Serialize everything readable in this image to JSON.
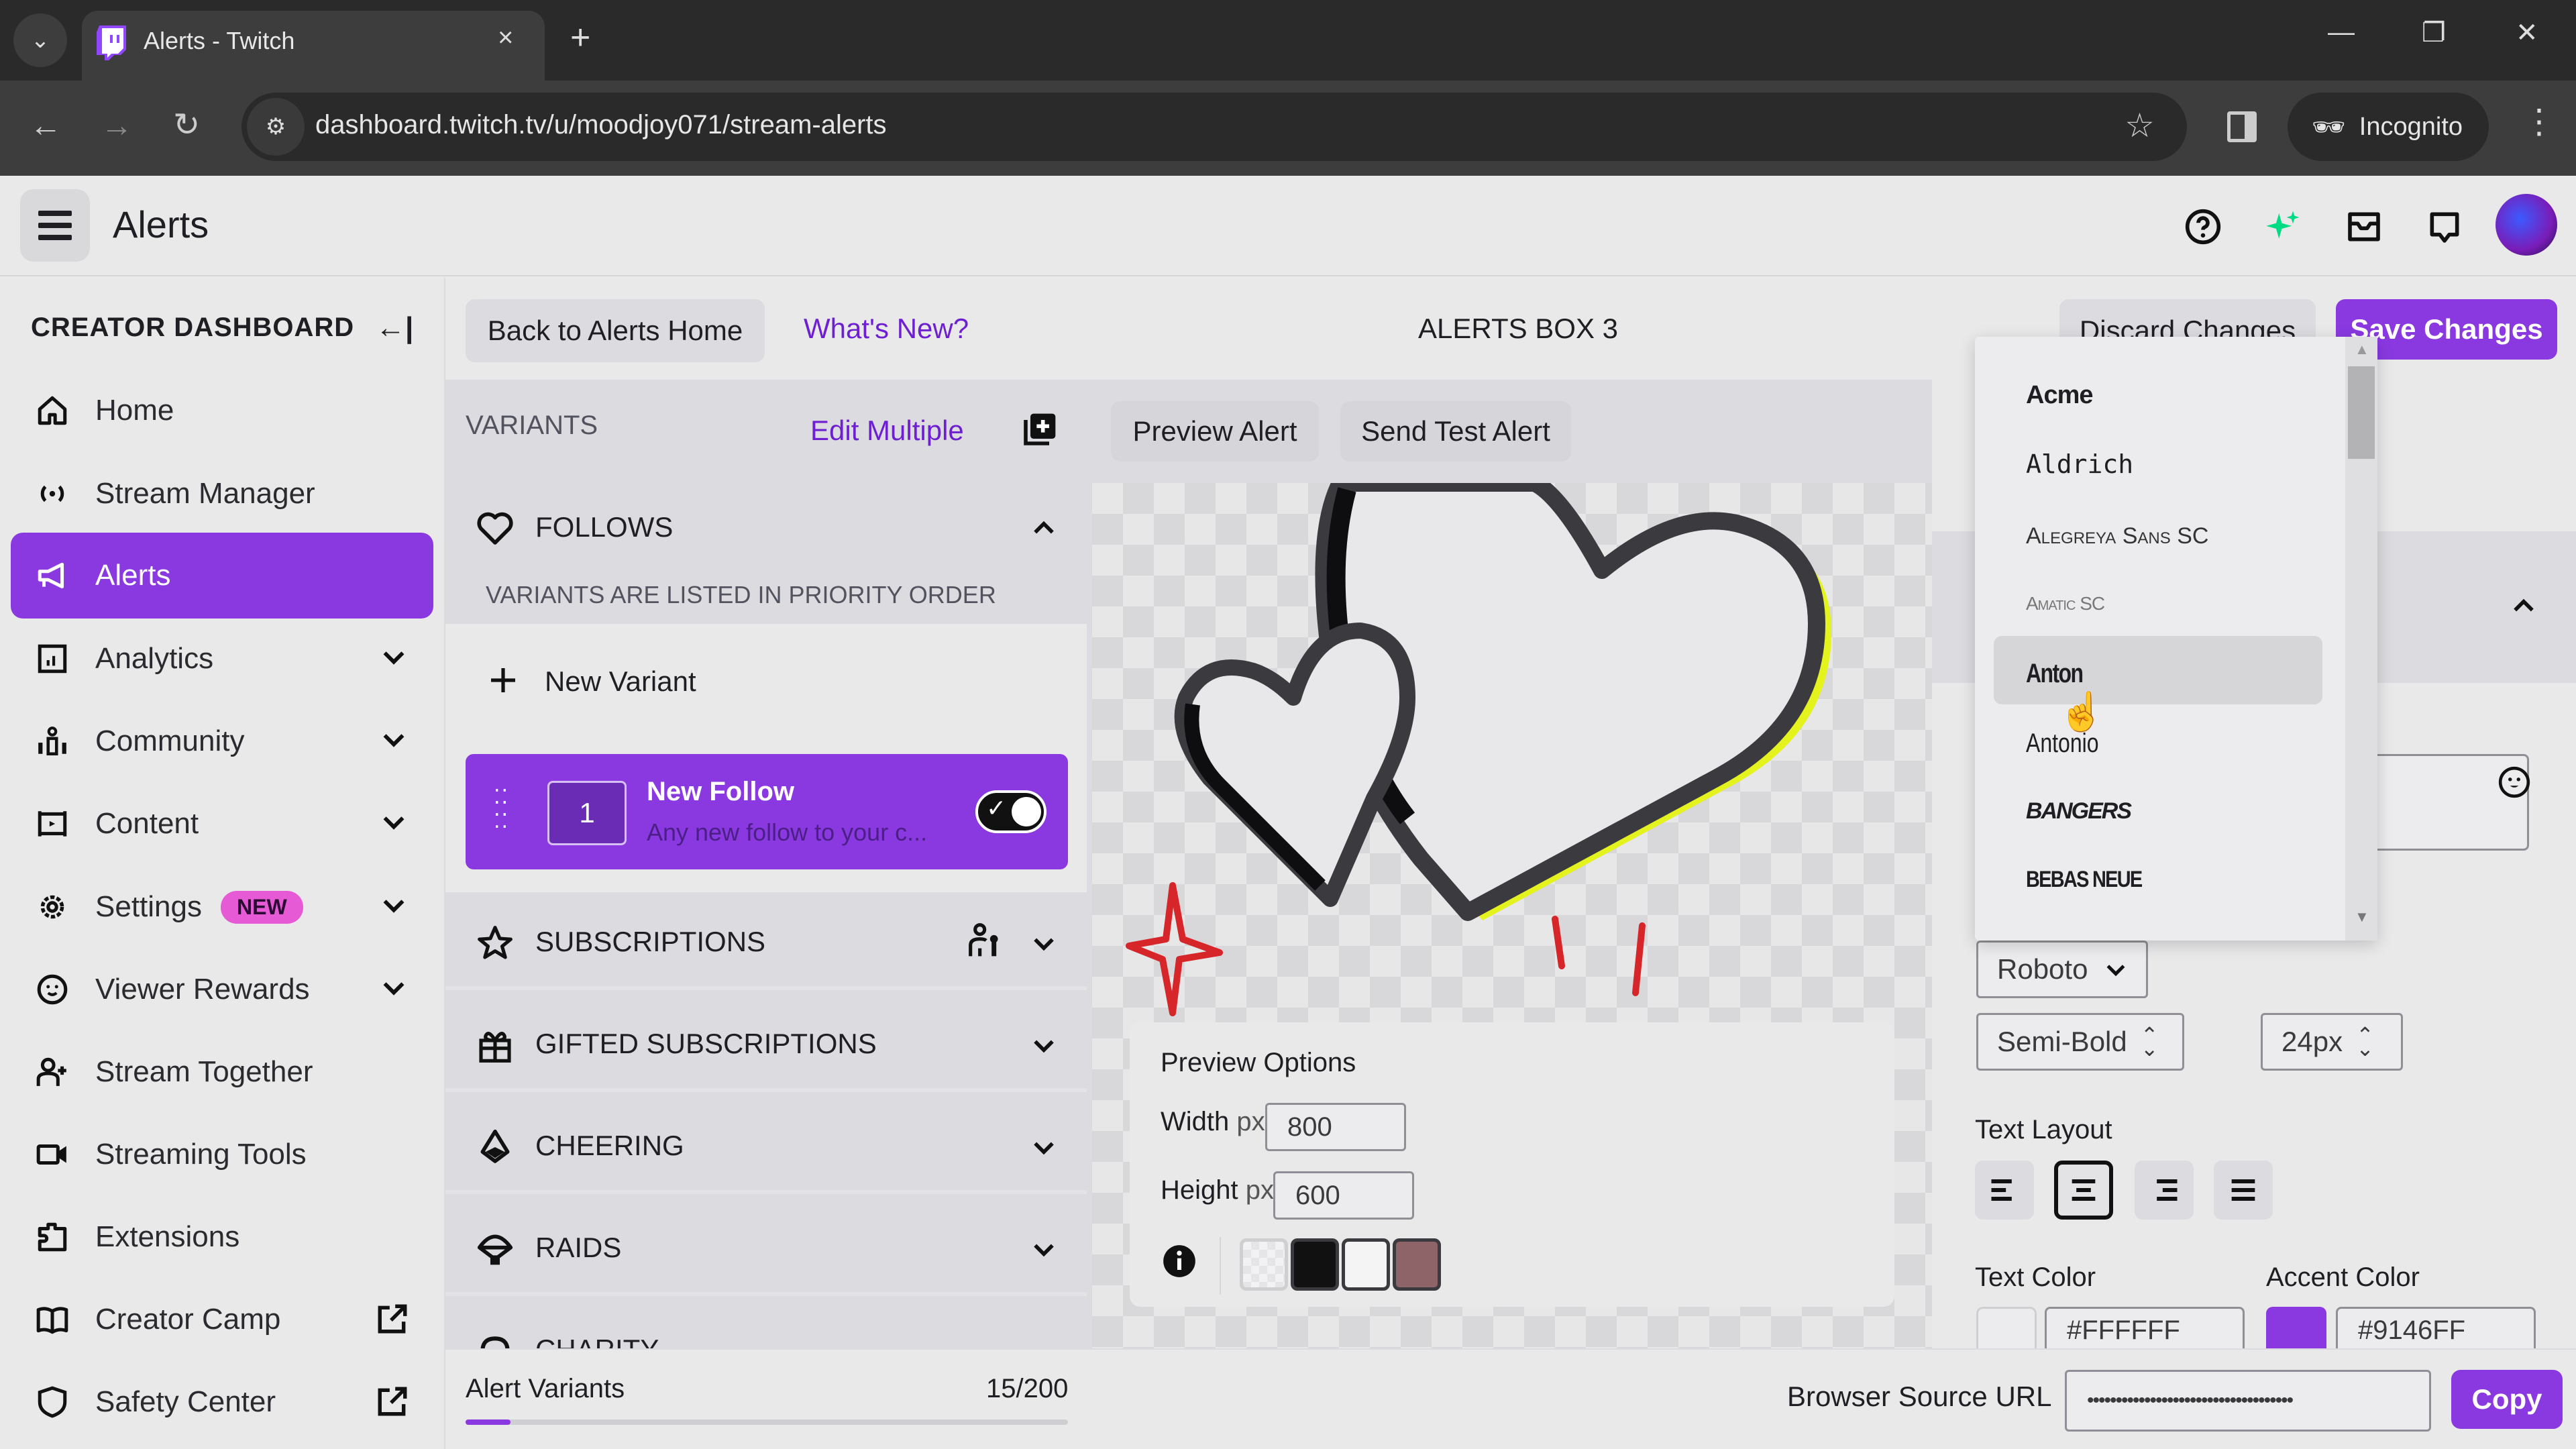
{
  "browser": {
    "tab_title": "Alerts - Twitch",
    "tab_close": "×",
    "new_tab": "+",
    "url": "dashboard.twitch.tv/u/moodjoy071/stream-alerts",
    "incognito_label": "Incognito",
    "window_controls": {
      "minimize": "—",
      "restore": "❐",
      "close": "✕"
    }
  },
  "topbar": {
    "title": "Alerts",
    "icons": [
      "help-icon",
      "sparkle-icon",
      "inbox-icon",
      "chat-icon",
      "avatar"
    ]
  },
  "sidebar": {
    "title": "CREATOR DASHBOARD",
    "collapse_glyph": "←|",
    "items": [
      {
        "label": "Home",
        "icon": "home-icon",
        "active": false,
        "expandable": false
      },
      {
        "label": "Stream Manager",
        "icon": "broadcast-icon",
        "active": false,
        "expandable": false
      },
      {
        "label": "Alerts",
        "icon": "megaphone-icon",
        "active": true,
        "expandable": false
      },
      {
        "label": "Analytics",
        "icon": "analytics-icon",
        "active": false,
        "expandable": true
      },
      {
        "label": "Community",
        "icon": "community-icon",
        "active": false,
        "expandable": true
      },
      {
        "label": "Content",
        "icon": "content-icon",
        "active": false,
        "expandable": true
      },
      {
        "label": "Settings",
        "icon": "gear-icon",
        "active": false,
        "expandable": true,
        "badge": "NEW"
      },
      {
        "label": "Viewer Rewards",
        "icon": "smile-icon",
        "active": false,
        "expandable": true
      },
      {
        "label": "Stream Together",
        "icon": "add-user-icon",
        "active": false,
        "expandable": false
      },
      {
        "label": "Streaming Tools",
        "icon": "camera-icon",
        "active": false,
        "expandable": false
      },
      {
        "label": "Extensions",
        "icon": "puzzle-icon",
        "active": false,
        "expandable": false
      },
      {
        "label": "Creator Camp",
        "icon": "book-icon",
        "active": false,
        "external": true
      },
      {
        "label": "Safety Center",
        "icon": "shield-icon",
        "active": false,
        "external": true
      }
    ]
  },
  "header": {
    "back_label": "Back to Alerts Home",
    "whats_new_label": "What's New?",
    "box_title": "ALERTS BOX 3",
    "discard_label": "Discard Changes",
    "save_label": "Save Changes"
  },
  "variants": {
    "heading": "VARIANTS",
    "edit_multiple": "Edit Multiple",
    "priority_note": "VARIANTS ARE LISTED IN PRIORITY ORDER",
    "new_variant": "New Variant",
    "sections": [
      {
        "label": "FOLLOWS",
        "icon": "heart-icon",
        "expanded": true
      },
      {
        "label": "SUBSCRIPTIONS",
        "icon": "star-icon",
        "expanded": false,
        "extra_icon": "subscriber-key-icon"
      },
      {
        "label": "GIFTED SUBSCRIPTIONS",
        "icon": "gift-icon",
        "expanded": false
      },
      {
        "label": "CHEERING",
        "icon": "bits-icon",
        "expanded": false
      },
      {
        "label": "RAIDS",
        "icon": "parachute-icon",
        "expanded": false
      },
      {
        "label": "CHARITY",
        "icon": "charity-icon",
        "expanded": false
      }
    ],
    "card": {
      "priority": "1",
      "title": "New Follow",
      "subtitle": "Any new follow to your c...",
      "enabled": true
    },
    "footer": {
      "label": "Alert Variants",
      "count_text": "15/200",
      "used": 15,
      "max": 200
    }
  },
  "preview": {
    "preview_button": "Preview Alert",
    "test_button": "Send Test Alert",
    "options_title": "Preview Options",
    "width_label": "Width",
    "height_label": "Height",
    "unit": "px",
    "width_value": "800",
    "height_value": "600",
    "backgrounds": [
      "transparent",
      "#111111",
      "#ffffff",
      "#8e6468"
    ],
    "colors": {
      "heart_outline": "#3a3a3f",
      "heart_shadow": "#0e0e10",
      "heart_accent": "#e4f21d",
      "spark": "#d6262a",
      "fill": "#e8e8ea"
    }
  },
  "font_dropdown": {
    "options": [
      {
        "label": "Acme",
        "hover": false
      },
      {
        "label": "Aldrich",
        "hover": false
      },
      {
        "label": "Alegreya Sans SC",
        "hover": false
      },
      {
        "label": "Amatic SC",
        "hover": false
      },
      {
        "label": "Anton",
        "hover": true
      },
      {
        "label": "Antonio",
        "hover": false
      },
      {
        "label": "BANGERS",
        "hover": false
      },
      {
        "label": "BEBAS NEUE",
        "hover": false
      }
    ]
  },
  "settings": {
    "font_value": "Roboto",
    "weight_value": "Semi-Bold",
    "size_value": "24px",
    "text_layout_label": "Text Layout",
    "layout_options": [
      "align-left",
      "align-center",
      "align-right",
      "justify"
    ],
    "layout_selected": "align-center",
    "text_color_label": "Text Color",
    "text_color_value": "#FFFFFF",
    "accent_color_label": "Accent Color",
    "accent_color_value": "#9146FF",
    "accent_swatch": "#8a39e1"
  },
  "bottom": {
    "browser_source_label": "Browser Source URL",
    "browser_source_value": "••••••••••••••••••••••••••••••••••••",
    "copy_label": "Copy"
  },
  "theme": {
    "accent": "#8a39e1",
    "link": "#6d1fd1",
    "badge_new": "#e65ad6",
    "sparkle": "#00db84"
  }
}
